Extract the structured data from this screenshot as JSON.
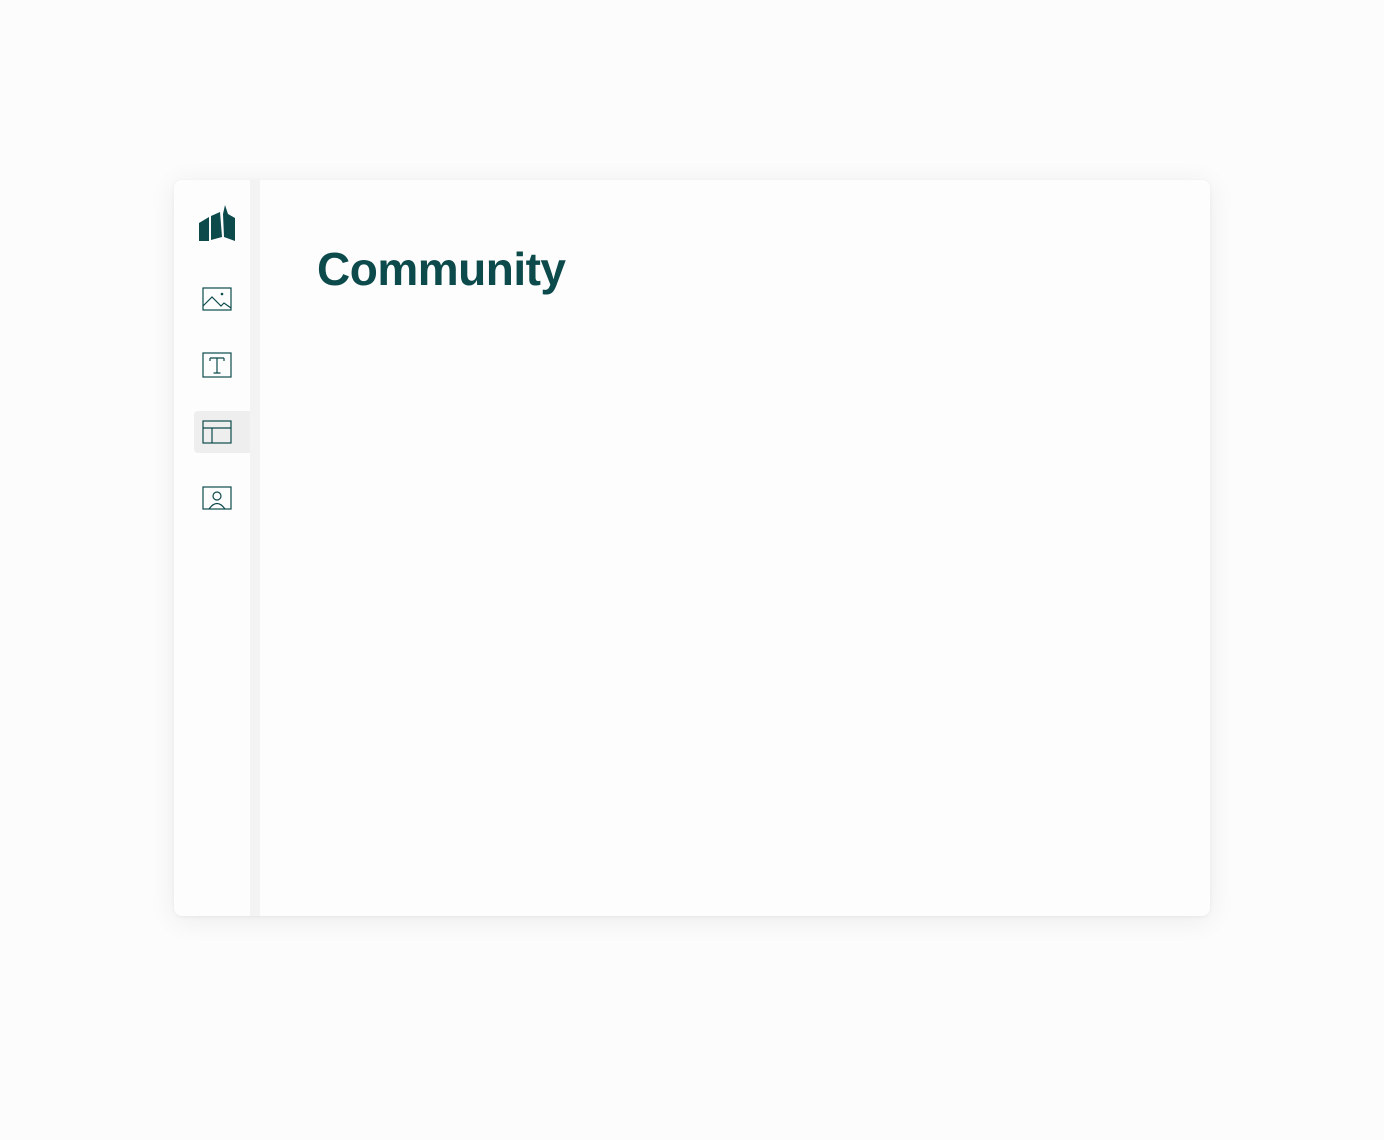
{
  "colors": {
    "brand": "#0d4a4c",
    "background": "#fcfcfc",
    "active_nav_bg": "#eeeeee"
  },
  "sidebar": {
    "logo": "brand-logo-icon",
    "items": [
      {
        "icon": "image-icon",
        "active": false
      },
      {
        "icon": "text-icon",
        "active": false
      },
      {
        "icon": "layout-icon",
        "active": true
      },
      {
        "icon": "profile-card-icon",
        "active": false
      }
    ]
  },
  "main": {
    "title": "Community"
  }
}
